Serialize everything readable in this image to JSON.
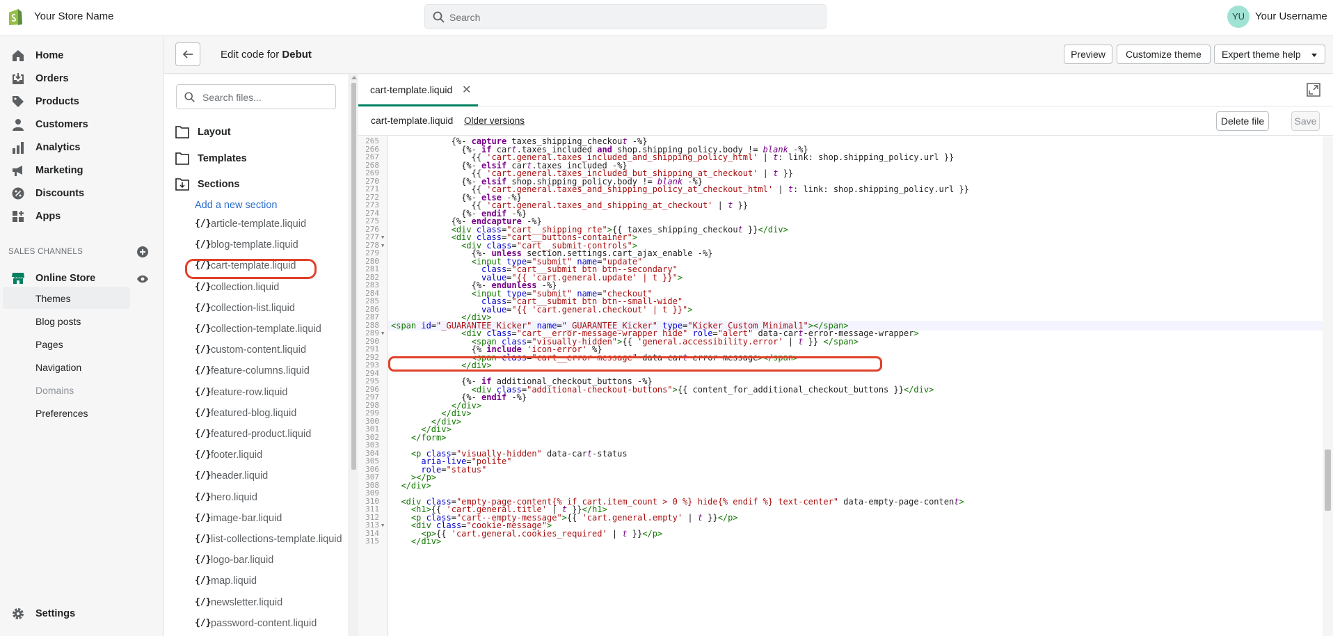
{
  "topbar": {
    "store_name": "Your Store Name",
    "search_placeholder": "Search",
    "avatar_initials": "YU",
    "username": "Your Username"
  },
  "nav": {
    "items": [
      {
        "label": "Home",
        "icon": "home-icon"
      },
      {
        "label": "Orders",
        "icon": "orders-icon"
      },
      {
        "label": "Products",
        "icon": "tag-icon"
      },
      {
        "label": "Customers",
        "icon": "person-icon"
      },
      {
        "label": "Analytics",
        "icon": "bar-chart-icon"
      },
      {
        "label": "Marketing",
        "icon": "megaphone-icon"
      },
      {
        "label": "Discounts",
        "icon": "discount-icon"
      },
      {
        "label": "Apps",
        "icon": "apps-icon"
      }
    ],
    "sales_channels_header": "SALES CHANNELS",
    "online_store": "Online Store",
    "sub_items": [
      "Themes",
      "Blog posts",
      "Pages",
      "Navigation",
      "Domains",
      "Preferences"
    ],
    "settings": "Settings"
  },
  "editor_header": {
    "title_prefix": "Edit code for ",
    "theme_name": "Debut",
    "preview": "Preview",
    "customize": "Customize theme",
    "expert_help": "Expert theme help"
  },
  "file_panel": {
    "search_placeholder": "Search files...",
    "folders": [
      "Layout",
      "Templates",
      "Sections"
    ],
    "add_section": "Add a new section",
    "file_icon": "{/}",
    "files": [
      "article-template.liquid",
      "blog-template.liquid",
      "cart-template.liquid",
      "collection.liquid",
      "collection-list.liquid",
      "collection-template.liquid",
      "custom-content.liquid",
      "feature-columns.liquid",
      "feature-row.liquid",
      "featured-blog.liquid",
      "featured-product.liquid",
      "footer.liquid",
      "header.liquid",
      "hero.liquid",
      "image-bar.liquid",
      "list-collections-template.liquid",
      "logo-bar.liquid",
      "map.liquid",
      "newsletter.liquid",
      "password-content.liquid"
    ]
  },
  "editor": {
    "tab_label": "cart-template.liquid",
    "file_name": "cart-template.liquid",
    "older_versions": "Older versions",
    "delete_file": "Delete file",
    "save": "Save",
    "first_line": 265,
    "folded_lines": [
      277,
      278,
      289,
      313
    ],
    "lines": [
      "            {%- capture taxes_shipping_checkout -%}",
      "              {%- if cart.taxes_included and shop.shipping_policy.body != blank -%}",
      "                {{ 'cart.general.taxes_included_and_shipping_policy_html' | t: link: shop.shipping_policy.url }}",
      "              {%- elsif cart.taxes_included -%}",
      "                {{ 'cart.general.taxes_included_but_shipping_at_checkout' | t }}",
      "              {%- elsif shop.shipping_policy.body != blank -%}",
      "                {{ 'cart.general.taxes_and_shipping_policy_at_checkout_html' | t: link: shop.shipping_policy.url }}",
      "              {%- else -%}",
      "                {{ 'cart.general.taxes_and_shipping_at_checkout' | t }}",
      "              {%- endif -%}",
      "            {%- endcapture -%}",
      "            <div class=\"cart__shipping rte\">{{ taxes_shipping_checkout }}</div>",
      "            <div class=\"cart__buttons-container\">",
      "              <div class=\"cart__submit-controls\">",
      "                {%- unless section.settings.cart_ajax_enable -%}",
      "                <input type=\"submit\" name=\"update\"",
      "                  class=\"cart__submit btn btn--secondary\"",
      "                  value=\"{{ 'cart.general.update' | t }}\">",
      "                {%- endunless -%}",
      "                <input type=\"submit\" name=\"checkout\"",
      "                  class=\"cart__submit btn btn--small-wide\"",
      "                  value=\"{{ 'cart.general.checkout' | t }}\">",
      "              </div>",
      "<span id=\"_GUARANTEE_Kicker\" name=\"_GUARANTEE_Kicker\" type=\"Kicker Custom Minimal1\"></span>",
      "              <div class=\"cart__error-message-wrapper hide\" role=\"alert\" data-cart-error-message-wrapper>",
      "                <span class=\"visually-hidden\">{{ 'general.accessibility.error' | t }} </span>",
      "                {% include 'icon-error' %}",
      "                <span class=\"cart__error-message\" data-cart-error-message></span>",
      "              </div>",
      "",
      "              {%- if additional_checkout_buttons -%}",
      "                <div class=\"additional-checkout-buttons\">{{ content_for_additional_checkout_buttons }}</div>",
      "              {%- endif -%}",
      "            </div>",
      "          </div>",
      "        </div>",
      "      </div>",
      "    </form>",
      "",
      "    <p class=\"visually-hidden\" data-cart-status",
      "      aria-live=\"polite\"",
      "      role=\"status\"",
      "    ></p>",
      "  </div>",
      "",
      "  <div class=\"empty-page-content{% if cart.item_count > 0 %} hide{% endif %} text-center\" data-empty-page-content>",
      "    <h1>{{ 'cart.general.title' | t }}</h1>",
      "    <p class=\"cart--empty-message\">{{ 'cart.general.empty' | t }}</p>",
      "    <div class=\"cookie-message\">",
      "      <p>{{ 'cart.general.cookies_required' | t }}</p>",
      "    </div>"
    ]
  }
}
